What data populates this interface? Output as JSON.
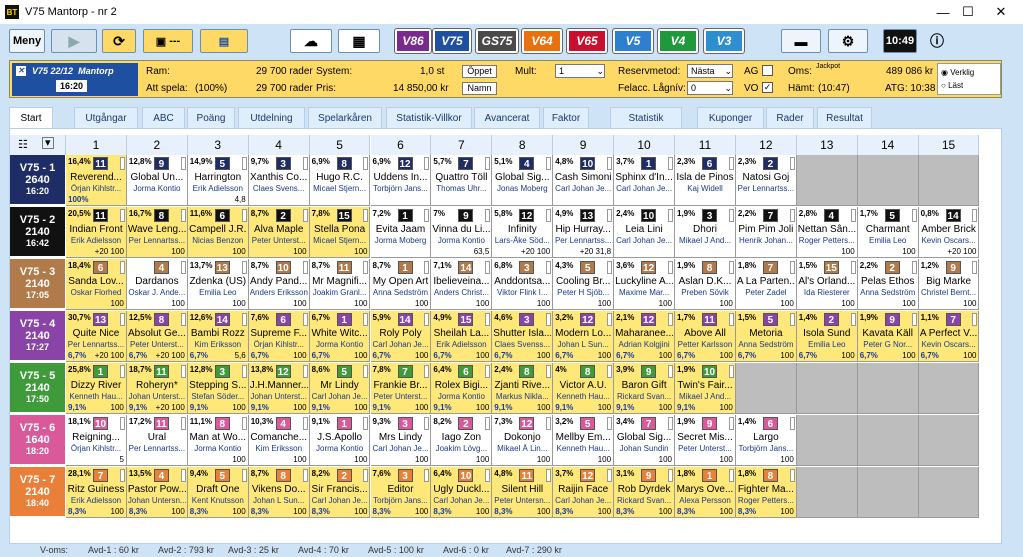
{
  "window": {
    "title": "V75 Mantorp - nr 2",
    "logo": "BT",
    "min": "—",
    "max": "☐",
    "close": "✕"
  },
  "toolbar": {
    "menu": "Meny",
    "play_icon": "play-icon",
    "refresh_icon": "refresh-icon",
    "save_label": "---",
    "clock": "10:49",
    "games": [
      {
        "label": "V86",
        "color": "#7a2a8c"
      },
      {
        "label": "V75",
        "color": "#1f4fa0"
      },
      {
        "label": "GS75",
        "color": "#4a4a4a"
      },
      {
        "label": "V64",
        "color": "#e8700e"
      },
      {
        "label": "V65",
        "color": "#c8102e"
      },
      {
        "label": "V5",
        "color": "#2e7fd0"
      },
      {
        "label": "V4",
        "color": "#1f9a3a"
      },
      {
        "label": "V3",
        "color": "#2e8fd0"
      }
    ]
  },
  "info": {
    "race_game": "V75",
    "race_date": "22/12",
    "race_track": "Mantorp",
    "race_time": "16:20",
    "ram_label": "Ram:",
    "ram_val": "29 700 rader",
    "att_label": "Att spela:",
    "att_pct": "(100%)",
    "att_val": "29 700 rader",
    "system_label": "System:",
    "system_val": "1,0 st",
    "pris_label": "Pris:",
    "pris_val": "14 850,00 kr",
    "oppet": "Öppet",
    "namn": "Namn",
    "mult_label": "Mult:",
    "mult_val": "1",
    "reserv_label": "Reservmetod:",
    "reserv_val": "Nästa",
    "felacc_label": "Felacc. Lågnív:",
    "felacc_val": "0",
    "ag_label": "AG",
    "vo_label": "VO",
    "oms_label": "Oms:",
    "jackpot": "Jackpot",
    "oms_val": "489 086 kr",
    "hamt_label": "Hämt:",
    "hamt_val": "(10:47)",
    "atg_val": "ATG: 10:38",
    "verklig": "Verklig",
    "last": "Läst"
  },
  "tabs": [
    "Start",
    "Utgångar",
    "ABC",
    "Poäng",
    "Utdelning",
    "Spelarkåren",
    "Statistik-Villkor",
    "Avancerat",
    "Faktor",
    "Statistik",
    "Kuponger",
    "Rader",
    "Resultat"
  ],
  "columns": [
    "1",
    "2",
    "3",
    "4",
    "5",
    "6",
    "7",
    "8",
    "9",
    "10",
    "11",
    "12",
    "13",
    "14",
    "15"
  ],
  "races": [
    {
      "label": "V75 - 1",
      "dist": "2640",
      "time": "16:20",
      "color": "#1f2d66",
      "cells": [
        [
          "16,4",
          "11",
          "Reverend...",
          "Örjan Kihlstr...",
          "100%",
          "",
          "y"
        ],
        [
          "12,8",
          "9",
          "Global Un...",
          "Jorma Kontio",
          "",
          "",
          "w"
        ],
        [
          "14,9",
          "5",
          "Harrington",
          "Erik Adielsson",
          "",
          "4,8",
          "w"
        ],
        [
          "9,7",
          "3",
          "Xanthis Co...",
          "Claes Svens...",
          "",
          "",
          "w"
        ],
        [
          "6,9",
          "8",
          "Hugo R.C.",
          "Micael Stjern...",
          "",
          "",
          "w"
        ],
        [
          "6,9",
          "12",
          "Uddens In...",
          "Torbjörn Jans...",
          "",
          "",
          "w"
        ],
        [
          "5,7",
          "7",
          "Quattro Töll",
          "Thomas Uhr...",
          "",
          "",
          "w"
        ],
        [
          "5,1",
          "4",
          "Global Sig...",
          "Jonas Moberg",
          "",
          "",
          "w"
        ],
        [
          "4,8",
          "10",
          "Cash Simoni",
          "Carl Johan Je...",
          "",
          "",
          "w"
        ],
        [
          "3,7",
          "1",
          "Sphinx d'In...",
          "Carl Johan Je...",
          "",
          "",
          "w"
        ],
        [
          "2,3",
          "6",
          "Isla de Pinos",
          "Kaj Widell",
          "",
          "",
          "w"
        ],
        [
          "2,3",
          "2",
          "Natosi Goj",
          "Per Lennartss...",
          "",
          "",
          "w"
        ],
        [
          "",
          "",
          "",
          "",
          "",
          "",
          "e"
        ],
        [
          "",
          "",
          "",
          "",
          "",
          "",
          "e"
        ],
        [
          "",
          "",
          "",
          "",
          "",
          "",
          "e"
        ]
      ]
    },
    {
      "label": "V75 - 2",
      "dist": "2140",
      "time": "16:42",
      "color": "#111111",
      "cells": [
        [
          "20,5",
          "11",
          "Indian Front",
          "Erik Adielsson",
          "",
          "+20 100",
          "y"
        ],
        [
          "16,7",
          "8",
          "Wave Leng...",
          "Per Lennartss...",
          "",
          "100",
          "y"
        ],
        [
          "11,6",
          "6",
          "Campell J.R.",
          "Nicias Benzon",
          "",
          "100",
          "y"
        ],
        [
          "8,7",
          "2",
          "Alva Maple",
          "Peter Unterst...",
          "",
          "100",
          "y"
        ],
        [
          "7,8",
          "15",
          "Stella Pona",
          "Micael Stjern...",
          "",
          "100",
          "y"
        ],
        [
          "7,2",
          "1",
          "Evita Jaam",
          "Jorma Moberg",
          "",
          "",
          "w"
        ],
        [
          "7",
          "9",
          "Vinna du Li...",
          "Jorma Kontio",
          "",
          "63,5",
          "w"
        ],
        [
          "5,8",
          "12",
          "Infinity",
          "Lars-Åke Söd...",
          "",
          "+20 100",
          "w"
        ],
        [
          "4,9",
          "13",
          "Hip Hurray...",
          "Per Lennartss...",
          "",
          "+20 31,8",
          "w"
        ],
        [
          "2,4",
          "10",
          "Leia Lini",
          "Carl Johan Je...",
          "",
          "",
          "w"
        ],
        [
          "1,9",
          "3",
          "Dhori",
          "Mikael J And...",
          "",
          "",
          "w"
        ],
        [
          "2,2",
          "7",
          "Pim Pim Joli",
          "Henrik Johan...",
          "",
          "",
          "w"
        ],
        [
          "2,8",
          "4",
          "Nettan Sân...",
          "Roger Petters...",
          "",
          "100",
          "w"
        ],
        [
          "1,7",
          "5",
          "Charmant",
          "Emilia Leo",
          "",
          "100",
          "w"
        ],
        [
          "0,8",
          "14",
          "Amber Brick",
          "Kevin Oscars...",
          "",
          "+20 100",
          "w"
        ]
      ]
    },
    {
      "label": "V75 - 3",
      "dist": "2140",
      "time": "17:05",
      "color": "#b07a4a",
      "cells": [
        [
          "18,4",
          "6",
          "Sanda Lov...",
          "Oskar Florhed",
          "",
          "100",
          "y"
        ],
        [
          "",
          "4",
          "Dardanos",
          "Oskar J. Ande...",
          "",
          "100",
          "w"
        ],
        [
          "13,7",
          "13",
          "Zdenka (US)",
          "Emilia Leo",
          "",
          "100",
          "w"
        ],
        [
          "8,7",
          "10",
          "Andy Pand...",
          "Anders Eriksson",
          "",
          "100",
          "w"
        ],
        [
          "8,7",
          "11",
          "Mr Magnifi...",
          "Joakim Granl...",
          "",
          "100",
          "w"
        ],
        [
          "8,7",
          "1",
          "My Open Art",
          "Anna Sedström",
          "",
          "100",
          "w"
        ],
        [
          "7,1",
          "14",
          "Ibelieveina...",
          "Anders Christ...",
          "",
          "100",
          "w"
        ],
        [
          "6,8",
          "3",
          "Anddontsa...",
          "Viktor Flink I...",
          "",
          "100",
          "w"
        ],
        [
          "4,3",
          "5",
          "Cooling Br...",
          "Peter H Sjöb...",
          "",
          "100",
          "w"
        ],
        [
          "3,6",
          "12",
          "Luckyline A...",
          "Maxime Mar...",
          "",
          "100",
          "w"
        ],
        [
          "1,9",
          "8",
          "Aslan D.K...",
          "Preben Sövik",
          "",
          "100",
          "w"
        ],
        [
          "1,8",
          "7",
          "A La Parten...",
          "Peter Zadel",
          "",
          "100",
          "w"
        ],
        [
          "1,5",
          "15",
          "Al's Orland...",
          "Ida Riesterer",
          "",
          "100",
          "w"
        ],
        [
          "2,2",
          "2",
          "Pelas Ethos",
          "Anna Sedström",
          "",
          "100",
          "w"
        ],
        [
          "1,2",
          "9",
          "Big Marke",
          "Christel Bernt...",
          "",
          "100",
          "w"
        ]
      ]
    },
    {
      "label": "V75 - 4",
      "dist": "2140",
      "time": "17:27",
      "color": "#8a44a8",
      "cells": [
        [
          "30,7",
          "13",
          "Quite Nice",
          "Per Lennartss...",
          "6,7%",
          "+20 100",
          "y"
        ],
        [
          "12,5",
          "8",
          "Absolut Ge...",
          "Peter Unterst...",
          "6,7%",
          "+20 100",
          "y"
        ],
        [
          "12,6",
          "14",
          "Bambi Rozz",
          "Kim Eriksson",
          "6,7%",
          "5,6",
          "y"
        ],
        [
          "7,6",
          "6",
          "Supreme F...",
          "Örjan Kihlstr...",
          "6,7%",
          "100",
          "y"
        ],
        [
          "6,7",
          "1",
          "White Witc...",
          "Jorma Kontio",
          "6,7%",
          "100",
          "y"
        ],
        [
          "5,9",
          "14",
          "Roly Poly",
          "Carl Johan Je...",
          "6,7%",
          "100",
          "y"
        ],
        [
          "4,9",
          "15",
          "Sheilah La...",
          "Erik Adielsson",
          "6,7%",
          "100",
          "y"
        ],
        [
          "4,6",
          "3",
          "Shutter Isla...",
          "Claes Svenss...",
          "6,7%",
          "100",
          "y"
        ],
        [
          "3,2",
          "12",
          "Modern Lo...",
          "Johan L Sun...",
          "6,7%",
          "100",
          "y"
        ],
        [
          "2,1",
          "12",
          "Maharanee...",
          "Adrian Kolgjini",
          "6,7%",
          "100",
          "y"
        ],
        [
          "1,7",
          "11",
          "Above All",
          "Petter Karlsson",
          "6,7%",
          "100",
          "y"
        ],
        [
          "1,5",
          "5",
          "Metoria",
          "Anna Sedström",
          "6,7%",
          "100",
          "y"
        ],
        [
          "1,4",
          "2",
          "Isola Sund",
          "Emilia Leo",
          "6,7%",
          "100",
          "y"
        ],
        [
          "1,9",
          "9",
          "Kavata Käll",
          "Peter G Nor...",
          "6,7%",
          "100",
          "y"
        ],
        [
          "1,1",
          "7",
          "A Perfect V...",
          "Kevin Oscars...",
          "6,7%",
          "100",
          "y"
        ]
      ]
    },
    {
      "label": "V75 - 5",
      "dist": "2140",
      "time": "17:50",
      "color": "#3f9a3a",
      "cells": [
        [
          "25,8",
          "1",
          "Dizzy River",
          "Kenneth Hau...",
          "9,1%",
          "100",
          "y"
        ],
        [
          "18,7",
          "11",
          "Roheryn*",
          "Johan Unterst...",
          "9,1%",
          "+20 100",
          "y"
        ],
        [
          "12,8",
          "3",
          "Stepping S...",
          "Stefan Söder...",
          "9,1%",
          "100",
          "y"
        ],
        [
          "13,8",
          "12",
          "J.H.Manner...",
          "Johan Unterst...",
          "9,1%",
          "100",
          "y"
        ],
        [
          "8,6",
          "5",
          "Mr Lindy",
          "Carl Johan Je...",
          "9,1%",
          "100",
          "y"
        ],
        [
          "7,8",
          "7",
          "Frankie Br...",
          "Peter Unterst...",
          "9,1%",
          "100",
          "y"
        ],
        [
          "6,4",
          "6",
          "Rolex Bigi...",
          "Jorma Kontio",
          "9,1%",
          "100",
          "y"
        ],
        [
          "2,4",
          "8",
          "Zjanti Rive...",
          "Markus Nikla...",
          "9,1%",
          "100",
          "y"
        ],
        [
          "4",
          "8",
          "Victor A.U.",
          "Kenneth Hau...",
          "9,1%",
          "100",
          "y"
        ],
        [
          "3,9",
          "9",
          "Baron Gift",
          "Rickard Svan...",
          "9,1%",
          "100",
          "y"
        ],
        [
          "1,9",
          "10",
          "Twin's Fair...",
          "Mikael J And...",
          "9,1%",
          "100",
          "y"
        ],
        [
          "",
          "",
          "",
          "",
          "",
          "",
          "e"
        ],
        [
          "",
          "",
          "",
          "",
          "",
          "",
          "e"
        ],
        [
          "",
          "",
          "",
          "",
          "",
          "",
          "e"
        ],
        [
          "",
          "",
          "",
          "",
          "",
          "",
          "e"
        ]
      ]
    },
    {
      "label": "V75 - 6",
      "dist": "1640",
      "time": "18:20",
      "color": "#d85a9a",
      "cells": [
        [
          "18,1",
          "10",
          "Reigning...",
          "Örjan Kihlstr...",
          "",
          "5",
          "w"
        ],
        [
          "17,2",
          "11",
          "Ural",
          "Per Lennartss...",
          "",
          "",
          "w"
        ],
        [
          "11,1",
          "8",
          "Man at Wo...",
          "Jorma Kontio",
          "",
          "100",
          "w"
        ],
        [
          "10,3",
          "4",
          "Comanche...",
          "Kim Eriksson",
          "",
          "100",
          "w"
        ],
        [
          "9,1",
          "1",
          "J.S.Apollo",
          "Jorma Kontio",
          "",
          "100",
          "w"
        ],
        [
          "9,3",
          "3",
          "Mrs Lindy",
          "Carl Johan Je...",
          "",
          "100",
          "w"
        ],
        [
          "8,2",
          "2",
          "Iago Zon",
          "Joakim Lövg...",
          "",
          "100",
          "w"
        ],
        [
          "7,3",
          "12",
          "Dokonjo",
          "Mikael Å Lin...",
          "",
          "100",
          "w"
        ],
        [
          "3,2",
          "5",
          "Mellby Em...",
          "Kenneth Hau...",
          "",
          "100",
          "w"
        ],
        [
          "3,4",
          "7",
          "Global Sig...",
          "Johan Sundin",
          "",
          "100",
          "w"
        ],
        [
          "1,9",
          "9",
          "Secret Mis...",
          "Peter Unterst...",
          "",
          "100",
          "w"
        ],
        [
          "1,4",
          "6",
          "Largo",
          "Torbjörn Jans...",
          "",
          "100",
          "w"
        ],
        [
          "",
          "",
          "",
          "",
          "",
          "",
          "e"
        ],
        [
          "",
          "",
          "",
          "",
          "",
          "",
          "e"
        ],
        [
          "",
          "",
          "",
          "",
          "",
          "",
          "e"
        ]
      ]
    },
    {
      "label": "V75 - 7",
      "dist": "2140",
      "time": "18:40",
      "color": "#e8803a",
      "cells": [
        [
          "28,1",
          "7",
          "Ritz Guiness",
          "Erik Adielsson",
          "8,3%",
          "100",
          "y"
        ],
        [
          "13,5",
          "4",
          "Pastor Pow...",
          "Johan Untersn...",
          "8,3%",
          "100",
          "y"
        ],
        [
          "9,4",
          "5",
          "Draft One",
          "Kent Knutsson",
          "8,3%",
          "100",
          "y"
        ],
        [
          "8,7",
          "8",
          "Vikens Do...",
          "Johan L Sun...",
          "8,3%",
          "100",
          "y"
        ],
        [
          "8,2",
          "2",
          "Sir Francis...",
          "Carl Johan Je...",
          "8,3%",
          "100",
          "y"
        ],
        [
          "7,6",
          "3",
          "Editor",
          "Torbjörn Jans...",
          "8,3%",
          "100",
          "y"
        ],
        [
          "6,4",
          "10",
          "Ugly Duckl...",
          "Carl Johan Je...",
          "8,3%",
          "100",
          "y"
        ],
        [
          "4,8",
          "11",
          "Silent Hill",
          "Peter Untersn...",
          "8,3%",
          "100",
          "y"
        ],
        [
          "3,7",
          "12",
          "Raijin Face",
          "Carl Johan Je...",
          "8,3%",
          "100",
          "y"
        ],
        [
          "3,1",
          "9",
          "Rob Dyrdek",
          "Rickard Svan...",
          "8,3%",
          "100",
          "y"
        ],
        [
          "1,8",
          "1",
          "Marys Ove...",
          "Alexa Persson",
          "8,3%",
          "100",
          "y"
        ],
        [
          "1,8",
          "8",
          "Fighter Ma...",
          "Roger Petters...",
          "8,3%",
          "100",
          "y"
        ],
        [
          "",
          "",
          "",
          "",
          "",
          "",
          "e"
        ],
        [
          "",
          "",
          "",
          "",
          "",
          "",
          "e"
        ],
        [
          "",
          "",
          "",
          "",
          "",
          "",
          "e"
        ]
      ]
    }
  ],
  "status": {
    "voms": "V-oms:",
    "avd": [
      "Avd-1 : 60 kr",
      "Avd-2 : 793 kr",
      "Avd-3 : 25 kr",
      "Avd-4 : 70 kr",
      "Avd-5 : 100 kr",
      "Avd-6 : 0 kr",
      "Avd-7 : 290 kr"
    ]
  }
}
